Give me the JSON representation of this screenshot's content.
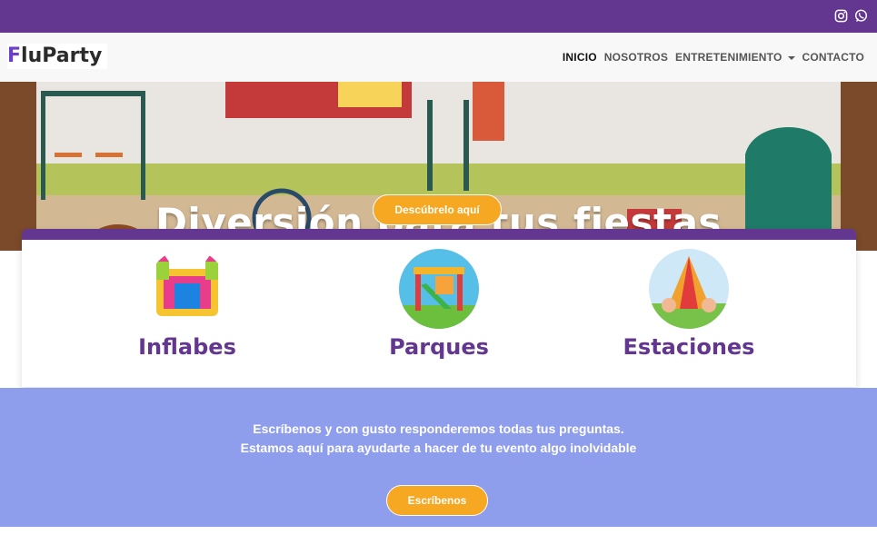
{
  "topbar": {
    "icons": [
      "instagram-icon",
      "whatsapp-icon"
    ],
    "color": "#63378f"
  },
  "brand": {
    "first_letter": "F",
    "rest": "luParty",
    "accent": "#6c3ec9"
  },
  "nav": {
    "items": [
      {
        "label": "INICIO",
        "active": true
      },
      {
        "label": "NOSOTROS",
        "active": false
      },
      {
        "label": "ENTRETENIMIENTO",
        "active": false,
        "dropdown": true
      },
      {
        "label": "CONTACTO",
        "active": false
      }
    ]
  },
  "hero": {
    "title": "Diversión para tus fiestas",
    "button_label": "Descúbrelo aquí"
  },
  "categories": [
    {
      "label": "Inflabes",
      "icon": "bounce-house-icon"
    },
    {
      "label": "Parques",
      "icon": "playground-icon"
    },
    {
      "label": "Estaciones",
      "icon": "tent-icon"
    }
  ],
  "contact": {
    "line1": "Escríbenos y con gusto responderemos todas tus preguntas.",
    "line2": "Estamos aquí para ayudarte a hacer de tu evento algo inolvidable",
    "button_label": "Escríbenos",
    "background": "#8e9eec"
  },
  "colors": {
    "orange": "#f6a823",
    "purple": "#63378f"
  }
}
